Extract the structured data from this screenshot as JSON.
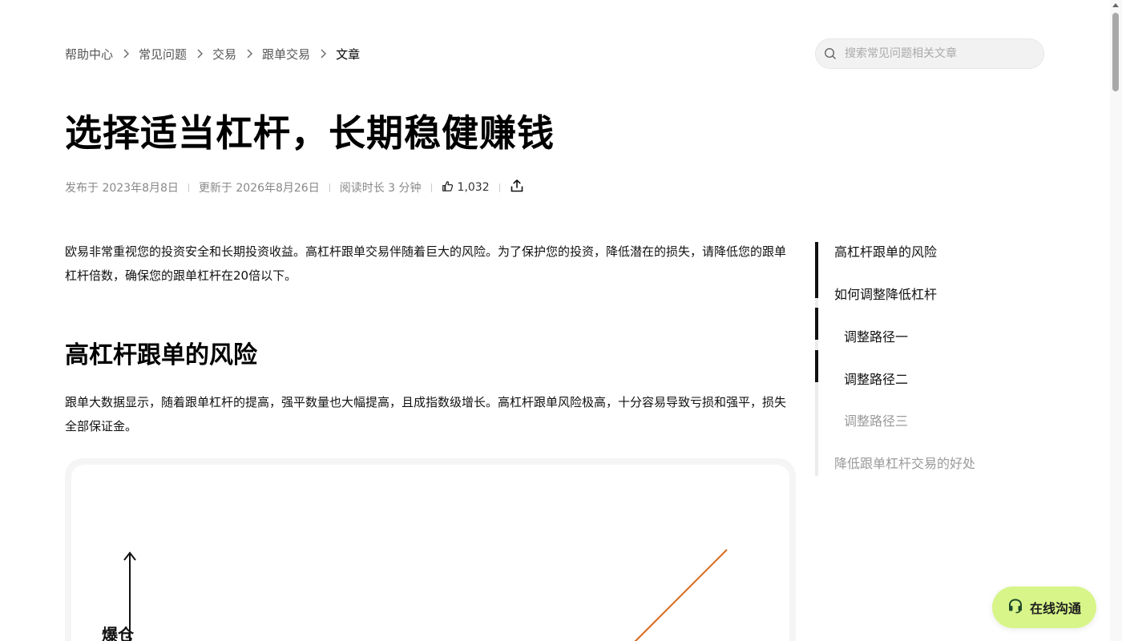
{
  "breadcrumb": {
    "items": [
      "帮助中心",
      "常见问题",
      "交易",
      "跟单交易"
    ],
    "current": "文章"
  },
  "search": {
    "placeholder": "搜索常见问题相关文章"
  },
  "article": {
    "title": "选择适当杠杆，长期稳健赚钱",
    "published": "发布于 2023年8月8日",
    "updated": "更新于 2026年8月26日",
    "read_time": "阅读时长 3 分钟",
    "likes": "1,032",
    "intro": "欧易非常重视您的投资安全和长期投资收益。高杠杆跟单交易伴随着巨大的风险。为了保护您的投资，降低潜在的损失，请降低您的跟单杠杆倍数，确保您的跟单杠杆在20倍以下。",
    "section1_heading": "高杠杆跟单的风险",
    "section1_text": "跟单大数据显示，随着跟单杠杆的提高，强平数量也大幅提高，且成指数级增长。高杠杆跟单风险极高，十分容易导致亏损和强平，损失全部保证金。",
    "figure_y_label": "爆仓"
  },
  "toc": {
    "items": [
      {
        "label": "高杠杆跟单的风险",
        "sub": false,
        "dim": false
      },
      {
        "label": "如何调整降低杠杆",
        "sub": false,
        "dim": false
      },
      {
        "label": "调整路径一",
        "sub": true,
        "dim": false
      },
      {
        "label": "调整路径二",
        "sub": true,
        "dim": false
      },
      {
        "label": "调整路径三",
        "sub": true,
        "dim": true
      },
      {
        "label": "降低跟单杠杆交易的好处",
        "sub": false,
        "dim": true
      }
    ]
  },
  "chat": {
    "label": "在线沟通"
  },
  "colors": {
    "chat_bg": "#d8f58a",
    "chart_line": "#d86a1e",
    "toc_active": "#111111"
  },
  "icons": {
    "search": "search-icon",
    "separator": "chevron-right-icon",
    "like": "thumbs-up-icon",
    "share": "share-icon",
    "chat": "headset-icon"
  }
}
